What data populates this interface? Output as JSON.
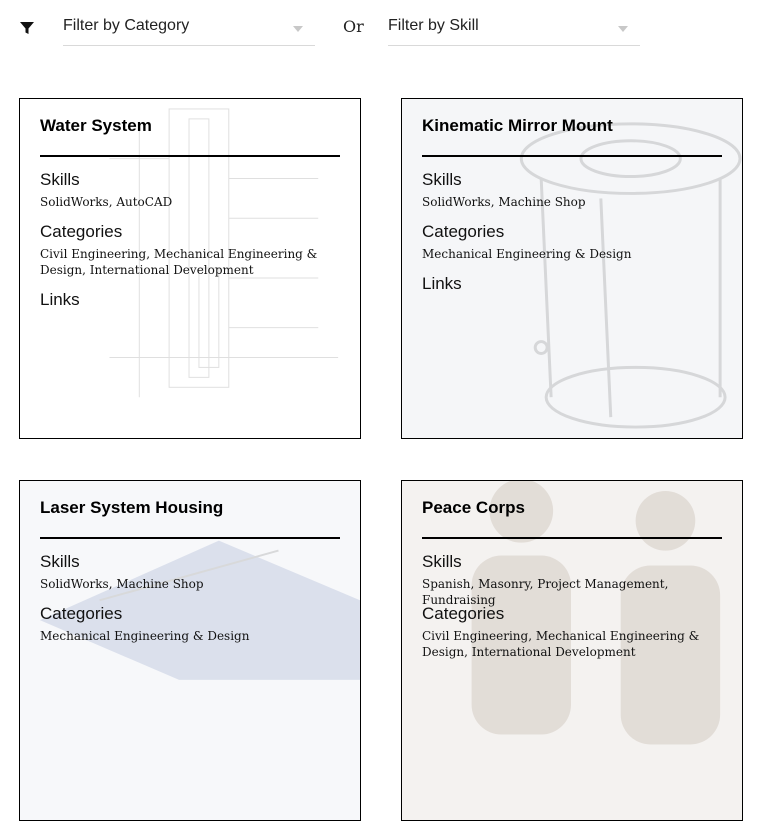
{
  "filters": {
    "category_placeholder": "Filter by Category",
    "or_label": "Or",
    "skill_placeholder": "Filter by Skill"
  },
  "headings": {
    "skills": "Skills",
    "categories": "Categories",
    "links": "Links"
  },
  "cards": [
    {
      "title": "Water System",
      "skills": "SolidWorks, AutoCAD",
      "categories": "Civil Engineering, Mechanical Engineering & Design, International Development"
    },
    {
      "title": "Kinematic Mirror Mount",
      "skills": "SolidWorks, Machine Shop",
      "categories": "Mechanical Engineering & Design"
    },
    {
      "title": "Laser System Housing",
      "skills": "SolidWorks, Machine Shop",
      "categories": "Mechanical Engineering & Design"
    },
    {
      "title": "Peace Corps",
      "skills": "Spanish, Masonry, Project Management, Fundraising",
      "categories": "Civil Engineering, Mechanical Engineering & Design, International Development"
    }
  ]
}
